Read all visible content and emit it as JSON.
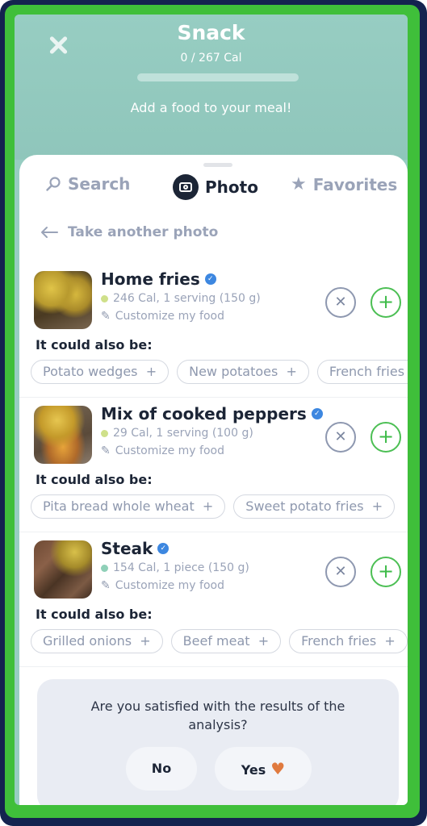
{
  "header": {
    "title": "Snack",
    "calories": "0 / 267 Cal",
    "progress_fraction": 0,
    "subtitle": "Add a food to your meal!"
  },
  "tabs": [
    {
      "label": "Search",
      "icon": "search-icon",
      "active": false
    },
    {
      "label": "Photo",
      "icon": "camera-icon",
      "active": true
    },
    {
      "label": "Favorites",
      "icon": "star-icon",
      "active": false
    }
  ],
  "back_link": "Take another photo",
  "foods": [
    {
      "name": "Home fries",
      "verified": true,
      "details": "246 Cal, 1 serving (150 g)",
      "dot_color": "#cfe08a",
      "customize": "Customize my food",
      "also_label": "It could also be:",
      "alternatives": [
        "Potato wedges",
        "New potatoes",
        "French fries"
      ]
    },
    {
      "name": "Mix of cooked peppers",
      "verified": true,
      "details": "29 Cal, 1 serving (100 g)",
      "dot_color": "#cfe08a",
      "customize": "Customize my food",
      "also_label": "It could also be:",
      "alternatives": [
        "Pita bread whole wheat",
        "Sweet potato fries"
      ]
    },
    {
      "name": "Steak",
      "verified": true,
      "details": "154 Cal, 1 piece (150 g)",
      "dot_color": "#8fd0b8",
      "customize": "Customize my food",
      "also_label": "It could also be:",
      "alternatives": [
        "Grilled onions",
        "Beef meat",
        "French fries"
      ]
    }
  ],
  "survey": {
    "question": "Are you satisfied with the results of the analysis?",
    "no_label": "No",
    "yes_label": "Yes"
  },
  "colors": {
    "header_bg": "#97cdc2",
    "add_green": "#4cbf54",
    "heart": "#e07a3f",
    "verified_blue": "#3d87e0"
  }
}
